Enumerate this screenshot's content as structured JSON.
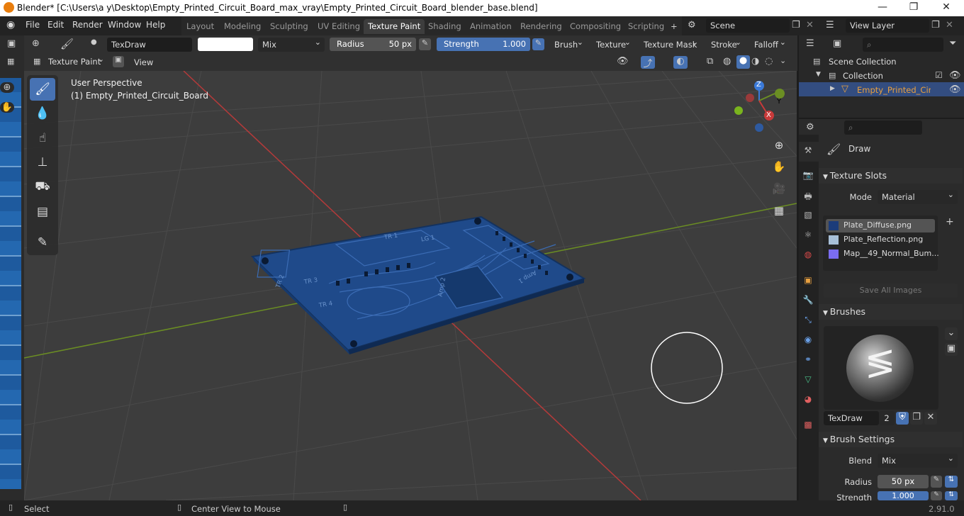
{
  "window": {
    "title": "Blender* [C:\\Users\\a y\\Desktop\\Empty_Printed_Circuit_Board_max_vray\\Empty_Printed_Circuit_Board_blender_base.blend]"
  },
  "menu": [
    "File",
    "Edit",
    "Render",
    "Window",
    "Help"
  ],
  "workspaces": [
    "Layout",
    "Modeling",
    "Sculpting",
    "UV Editing",
    "Texture Paint",
    "Shading",
    "Animation",
    "Rendering",
    "Compositing",
    "Scripting"
  ],
  "active_workspace": "Texture Paint",
  "scene": "Scene",
  "view_layer": "View Layer",
  "toolbar": {
    "brush_name": "TexDraw",
    "blend": "Mix",
    "radius_label": "Radius",
    "radius_value": "50 px",
    "strength_label": "Strength",
    "strength_value": "1.000",
    "strength_fraction": 1.0,
    "brush": "Brush",
    "texture": "Texture",
    "texture_mask": "Texture Mask",
    "stroke": "Stroke",
    "falloff": "Falloff"
  },
  "mode": {
    "label": "Texture Paint",
    "view": "View"
  },
  "viewport": {
    "perspective": "User Perspective",
    "object": "(1) Empty_Printed_Circuit_Board",
    "gizmo": {
      "x": "X",
      "y": "Y",
      "z": "Z"
    },
    "board_labels": [
      "TR 1",
      "LG 1",
      "TR 2",
      "TR 3",
      "TR 4",
      "Amp 1",
      "Amp 2"
    ]
  },
  "outliner": {
    "items": [
      {
        "label": "Scene Collection"
      },
      {
        "label": "Collection"
      },
      {
        "label": "Empty_Printed_Circu"
      }
    ]
  },
  "properties": {
    "active_tool": "Draw",
    "texture_slots_title": "Texture Slots",
    "mode_label": "Mode",
    "mode_value": "Material",
    "slots": [
      {
        "name": "Plate_Diffuse.png",
        "color": "#1c3c7a"
      },
      {
        "name": "Plate_Reflection.png",
        "color": "#a8c0d8"
      },
      {
        "name": "Map__49_Normal_Bum...",
        "color": "#7a6cf0"
      }
    ],
    "save_all": "Save All Images",
    "brushes_title": "Brushes",
    "brush_name": "TexDraw",
    "brush_users": "2",
    "brush_settings_title": "Brush Settings",
    "blend_label": "Blend",
    "blend_value": "Mix",
    "radius_label": "Radius",
    "radius_value": "50 px",
    "strength_label": "Strength",
    "strength_value": "1.000"
  },
  "status": {
    "select": "Select",
    "center": "Center View to Mouse",
    "version": "2.91.0"
  },
  "colors": {
    "accent": "#4772b3",
    "board": "#1f4a8a",
    "x_axis": "#b53a3a",
    "y_axis": "#6b8e23"
  }
}
